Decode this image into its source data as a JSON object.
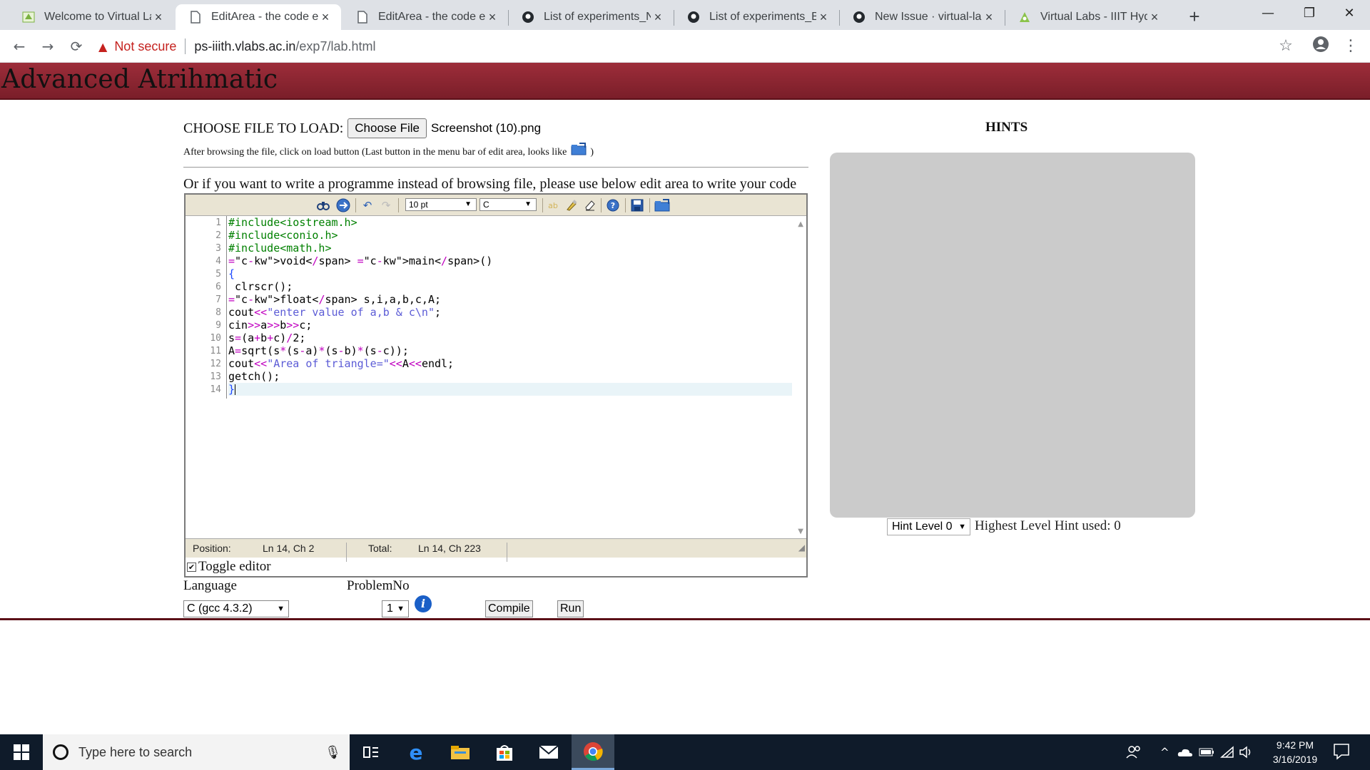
{
  "browser": {
    "tabs": [
      {
        "title": "Welcome to Virtual Lab",
        "icon": "virtual-labs-icon",
        "active": false
      },
      {
        "title": "EditArea - the code edi",
        "icon": "document-icon",
        "active": true
      },
      {
        "title": "EditArea - the code edi",
        "icon": "document-icon",
        "active": false
      },
      {
        "title": "List of experiments_Nu",
        "icon": "github-icon",
        "active": false
      },
      {
        "title": "List of experiments_Be",
        "icon": "github-icon",
        "active": false
      },
      {
        "title": "New Issue · virtual-labs",
        "icon": "github-icon",
        "active": false
      },
      {
        "title": "Virtual Labs - IIIT Hyde",
        "icon": "virtual-labs-icon",
        "active": false
      }
    ],
    "tab_close": "×",
    "new_tab": "+",
    "window_controls": {
      "minimize": "—",
      "maximize": "❐",
      "close": "✕"
    },
    "nav": {
      "back": "←",
      "forward": "→",
      "reload": "⟳"
    },
    "security_label": "Not secure",
    "url_host": "ps-iiith.vlabs.ac.in",
    "url_path": "/exp7/lab.html",
    "star": "☆",
    "menu": "⋮"
  },
  "page": {
    "title": "Advanced Atrihmatic",
    "choose_label": "CHOOSE FILE TO LOAD:",
    "choose_button": "Choose File",
    "chosen_file": "Screenshot (10).png",
    "after_browse_text": "After browsing the file, click on load button (Last button in the menu bar of edit area, looks like",
    "after_browse_close": ")",
    "or_text": "Or if you want to write a programme instead of browsing file, please use below edit area to write your code",
    "editor": {
      "font_size": "10 pt",
      "syntax": "C",
      "line_numbers": [
        "1",
        "2",
        "3",
        "4",
        "5",
        "6",
        "7",
        "8",
        "9",
        "10",
        "11",
        "12",
        "13",
        "14"
      ],
      "code_lines": [
        "#include<iostream.h>",
        "#include<conio.h>",
        "#include<math.h>",
        "void main()",
        "{",
        " clrscr();",
        "float s,i,a,b,c,A;",
        "cout<<\"enter value of a,b & c\\n\";",
        "cin>>a>>b>>c;",
        "s=(a+b+c)/2;",
        "A=sqrt(s*(s-a)*(s-b)*(s-c));",
        "cout<<\"Area of triangle=\"<<A<<endl;",
        "getch();",
        "}"
      ],
      "status": {
        "position_label": "Position:",
        "position_value": "Ln 14, Ch 2",
        "total_label": "Total:",
        "total_value": "Ln 14, Ch 223"
      },
      "toggle_label": "Toggle editor",
      "toggle_checked": true
    },
    "language_label": "Language",
    "language_value": "C (gcc 4.3.2)",
    "problem_label": "ProblemNo",
    "problem_value": "1",
    "compile_button": "Compile",
    "run_button": "Run",
    "hints": {
      "title": "HINTS",
      "level_select": "Hint Level 0",
      "used_text": "Highest Level Hint used: 0"
    }
  },
  "taskbar": {
    "search_placeholder": "Type here to search",
    "time": "9:42 PM",
    "date": "3/16/2019"
  },
  "colors": {
    "banner": "#8b2633",
    "hints_box": "#cbcbcb",
    "editor_toolbar": "#e9e4d3",
    "taskbar": "#0f1b2a"
  }
}
